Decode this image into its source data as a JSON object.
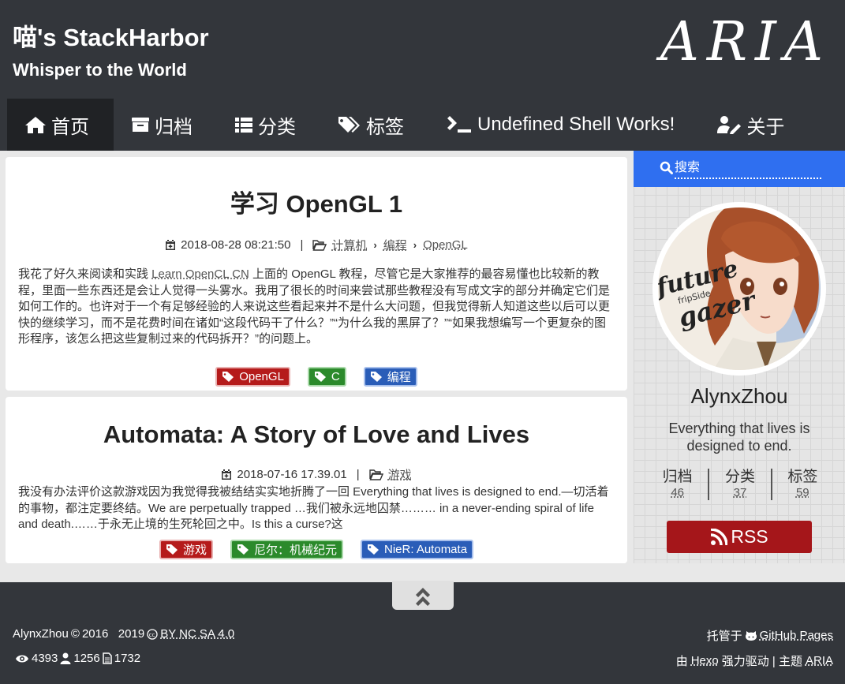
{
  "header": {
    "site_title": "喵's StackHarbor",
    "site_subtitle": "Whisper to the World",
    "theme_logo": "ARIA"
  },
  "nav": {
    "items": [
      {
        "label": "首页",
        "icon": "home-icon",
        "active": true
      },
      {
        "label": "归档",
        "icon": "archive-icon",
        "active": false
      },
      {
        "label": "分类",
        "icon": "list-icon",
        "active": false
      },
      {
        "label": "标签",
        "icon": "tags-icon",
        "active": false
      },
      {
        "label": "Undefined Shell Works!",
        "icon": "terminal-icon",
        "active": false
      },
      {
        "label": "关于",
        "icon": "user-edit-icon",
        "active": false
      }
    ]
  },
  "posts": [
    {
      "title": "学习 OpenGL 1",
      "date": "2018-08-28 08:21:50",
      "categories": [
        "计算机",
        "编程",
        "OpenGL"
      ],
      "excerpt_pre": "我花了好久来阅读和实践 ",
      "excerpt_link": "Learn OpenCL CN",
      "excerpt_post": " 上面的 OpenGL 教程，尽管它是大家推荐的最容易懂也比较新的教程，里面一些东西还是会让人觉得一头雾水。我用了很长的时间来尝试那些教程没有写成文字的部分并确定它们是如何工作的。也许对于一个有足够经验的人来说这些看起来并不是什么大问题，但我觉得新人知道这些以后可以更快的继续学习，而不是花费时间在诸如“这段代码干了什么？”“为什么我的黑屏了？”“如果我想编写一个更复杂的图形程序，该怎么把这些复制过来的代码拆开？”的问题上。",
      "tags": [
        {
          "label": "OpenGL",
          "color": "#b51b1b"
        },
        {
          "label": "C",
          "color": "#2b8a2b"
        },
        {
          "label": "编程",
          "color": "#2a5db8"
        }
      ]
    },
    {
      "title": "Automata: A Story of Love and Lives",
      "date": "2018-07-16 17.39.01",
      "categories": [
        "游戏"
      ],
      "excerpt": "我没有办法评价这款游戏因为我觉得我被结结实实地折腾了一回 Everything that lives is designed to end.—切活着的事物，都注定要终结。We are perpetually trapped …我们被永远地囚禁……… in a never-ending spiral of life and death.……于永无止境的生死轮回之中。Is this a curse?这",
      "tags": [
        {
          "label": "游戏",
          "color": "#b51b1b"
        },
        {
          "label": "尼尔：机械纪元",
          "color": "#2b8a2b"
        },
        {
          "label": "NieR: Automata",
          "color": "#2a5db8"
        }
      ]
    }
  ],
  "sidebar": {
    "search_placeholder": "搜索",
    "avatar_text_line1": "future",
    "avatar_text_line2": "gazer",
    "avatar_text_small": "fripSide",
    "author_name": "AlynxZhou",
    "author_desc": "Everything that lives is designed to end.",
    "stats": [
      {
        "label": "归档",
        "count": "46"
      },
      {
        "label": "分类",
        "count": "37"
      },
      {
        "label": "标签",
        "count": "59"
      }
    ],
    "rss_label": "RSS"
  },
  "footer": {
    "author": "AlynxZhou",
    "years": "2016   2019",
    "license": "BY NC SA 4.0",
    "hosted_prefix": "托管于",
    "hosted_link": "GitHub Pages",
    "views": "4393",
    "visitors": "1256",
    "posts_count": "1732",
    "powered_prefix": "由",
    "powered_link": "Hexo",
    "powered_mid": "强力驱动 | 主题",
    "theme_link": "ARIA"
  },
  "colors": {
    "header_bg": "#33363b",
    "nav_active_bg": "#202225",
    "search_bg": "#2f6ff0",
    "rss_bg": "#a5161a",
    "tag_red": "#b51b1b",
    "tag_green": "#2b8a2b",
    "tag_blue": "#2a5db8"
  }
}
